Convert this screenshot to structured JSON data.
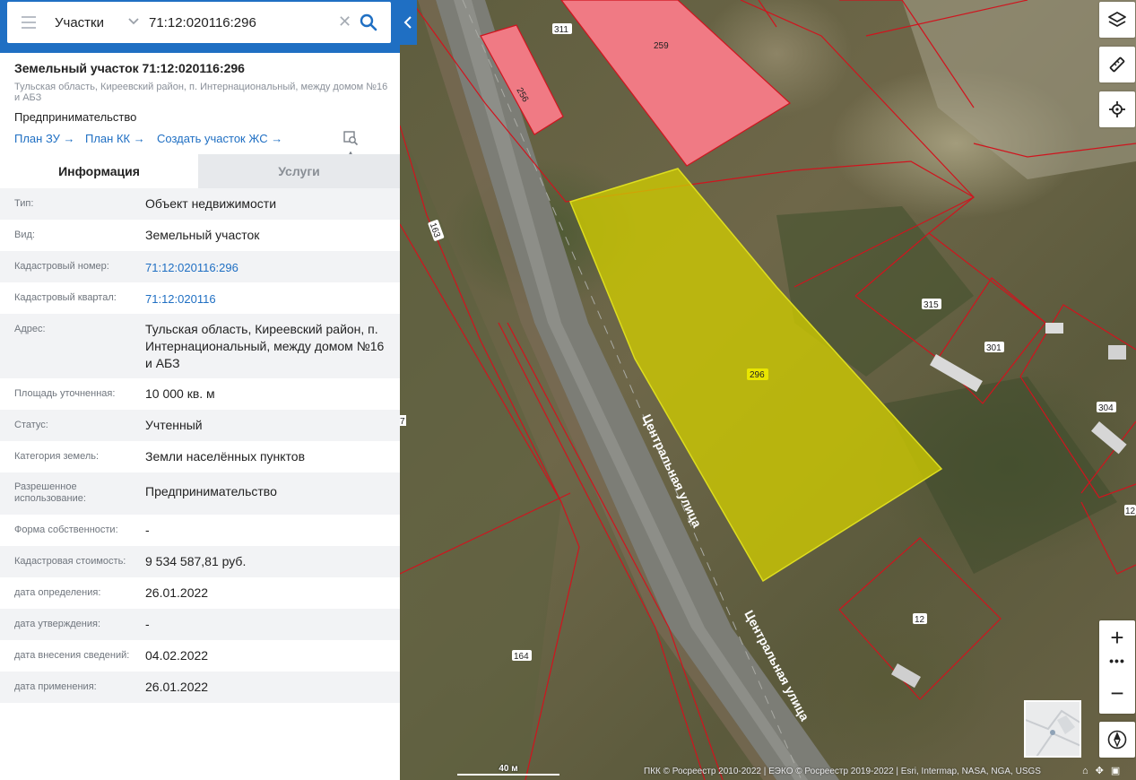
{
  "search": {
    "type": "Участки",
    "value": "71:12:020116:296"
  },
  "object": {
    "title": "Земельный участок 71:12:020116:296",
    "address": "Тульская область, Киреевский район, п. Интернациональный, между домом №16 и АБЗ",
    "use": "Предпринимательство",
    "links": [
      "План ЗУ →",
      "План КК →",
      "Создать участок ЖС →"
    ]
  },
  "tabs": {
    "info": "Информация",
    "services": "Услуги"
  },
  "info_rows": [
    {
      "label": "Тип:",
      "value": "Объект недвижимости"
    },
    {
      "label": "Вид:",
      "value": "Земельный участок"
    },
    {
      "label": "Кадастровый номер:",
      "value": "71:12:020116:296"
    },
    {
      "label": "Кадастровый квартал:",
      "value": "71:12:020116"
    },
    {
      "label": "Адрес:",
      "value": "Тульская область, Киреевский район, п. Интернациональный, между домом №16 и АБЗ"
    },
    {
      "label": "Площадь уточненная:",
      "value": "10 000 кв. м"
    },
    {
      "label": "Статус:",
      "value": "Учтенный"
    },
    {
      "label": "Категория земель:",
      "value": "Земли населённых пунктов"
    },
    {
      "label": "Разрешенное использование:",
      "value": "Предпринимательство"
    },
    {
      "label": "Форма собственности:",
      "value": "-"
    },
    {
      "label": "Кадастровая стоимость:",
      "value": "9 534 587,81 руб."
    },
    {
      "label": "дата определения:",
      "value": "26.01.2022"
    },
    {
      "label": "дата утверждения:",
      "value": "-"
    },
    {
      "label": "дата внесения сведений:",
      "value": "04.02.2022"
    },
    {
      "label": "дата применения:",
      "value": "26.01.2022"
    }
  ],
  "map": {
    "parcel_labels": [
      "311",
      "259",
      "256",
      "163",
      "296",
      "315",
      "301",
      "304",
      "12",
      "164",
      "12",
      "7"
    ],
    "street": "Центральная улица",
    "scale": "40 м",
    "copyright": "ПКК © Росреестр 2010-2022 | ЕЭКО © Росреестр 2019-2022 | Esri, Intermap, NASA, NGA, USGS"
  },
  "colors": {
    "brand_blue": "#1f6fc3",
    "selected_parcel": "#d4d000",
    "neighbor_parcel": "#f07a84",
    "boundary": "#d0141e"
  }
}
